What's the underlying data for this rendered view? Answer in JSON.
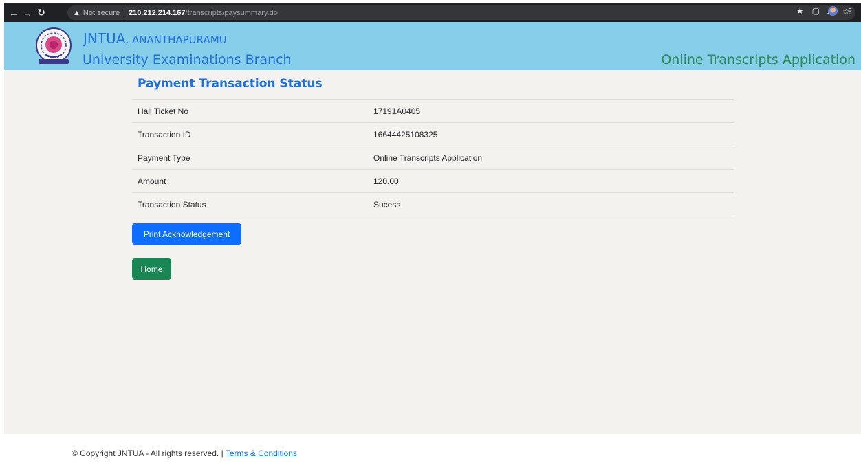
{
  "browser": {
    "security_label": "Not secure",
    "separator": "|",
    "host": "210.212.214.167",
    "path": "/transcripts/paysummary.do"
  },
  "header": {
    "org_name": "JNTUA",
    "org_location": ", ANANTHAPURAMU",
    "branch": "University Examinations Branch",
    "app_name": "Online Transcripts Application"
  },
  "page": {
    "title": "Payment Transaction Status",
    "rows": [
      {
        "label": "Hall Ticket No",
        "value": "17191A0405"
      },
      {
        "label": "Transaction ID",
        "value": "16644425108325"
      },
      {
        "label": "Payment Type",
        "value": "Online Transcripts Application"
      },
      {
        "label": "Amount",
        "value": "120.00"
      },
      {
        "label": "Transaction Status",
        "value": "Sucess"
      }
    ],
    "print_button": "Print Acknowledgement",
    "home_button": "Home"
  },
  "footer": {
    "copyright": "© Copyright JNTUA - All rights reserved. |",
    "terms_link": "Terms & Conditions"
  },
  "colors": {
    "header_bg": "#87ceeb",
    "title_blue": "#1e6fd9",
    "app_green": "#2e8b57",
    "primary_button": "#0d6efd",
    "success_button": "#198754"
  }
}
